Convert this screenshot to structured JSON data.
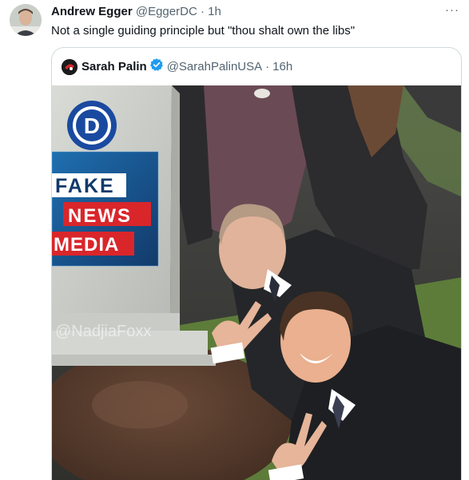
{
  "tweet": {
    "author_name": "Andrew Egger",
    "handle": "@EggerDC",
    "separator": "·",
    "time": "1h",
    "text": "Not a single guiding principle but \"thou shalt own the libs\"",
    "more_icon": "more-horizontal-icon",
    "more_label": "···"
  },
  "quote": {
    "author_name": "Sarah Palin",
    "verified_icon": "verified-badge-icon",
    "handle": "@SarahPalinUSA",
    "separator": "·",
    "time": "16h",
    "media": {
      "logo_letter": "D",
      "sign_line1": "FAKE",
      "sign_line2": "NEWS",
      "sign_line3": "MEDIA",
      "watermark": "@NadjiaFoxx"
    }
  },
  "colors": {
    "verified_blue": "#1d9bf0",
    "muted_text": "#536471",
    "border": "#cfd9de",
    "dem_blue": "#1a4aa0",
    "sign_red": "#d9262b"
  }
}
